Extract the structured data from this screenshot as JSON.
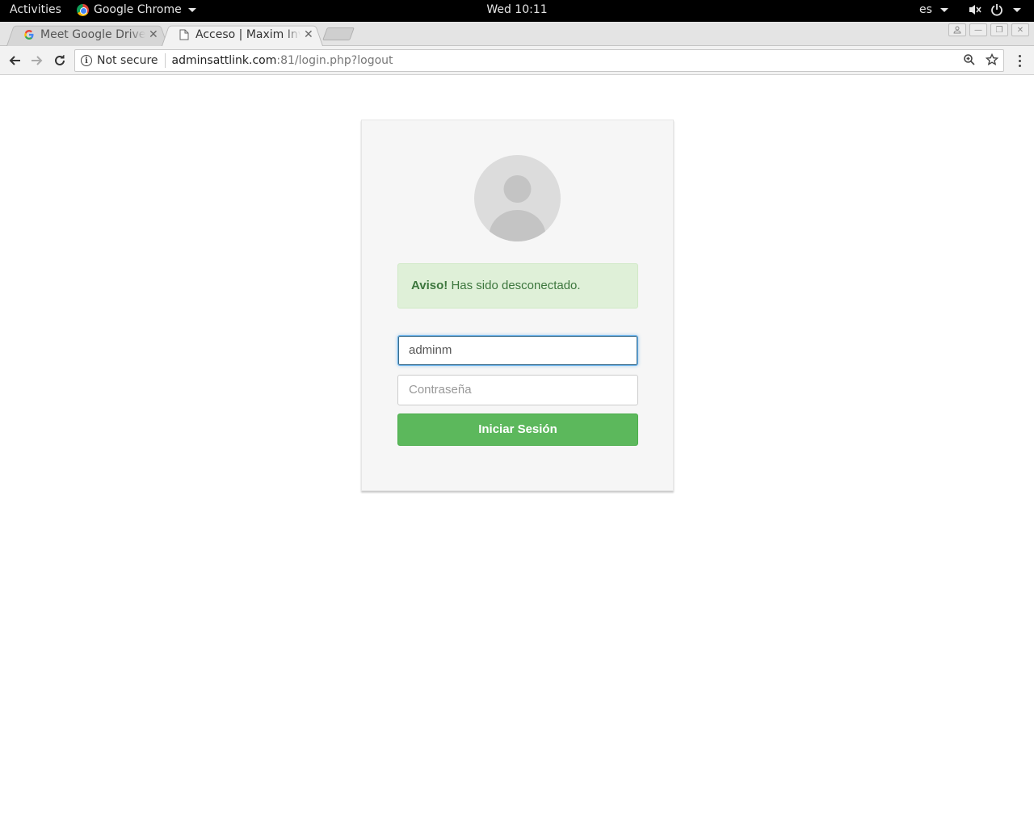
{
  "topbar": {
    "activities": "Activities",
    "app_name": "Google Chrome",
    "clock": "Wed 10:11",
    "lang": "es"
  },
  "tabs": [
    {
      "title": "Meet Google Drive",
      "icon": "google-icon",
      "active": false
    },
    {
      "title": "Acceso | Maxim Inventory",
      "icon": "page-icon",
      "active": true
    }
  ],
  "omnibox": {
    "security": "Not secure",
    "host": "adminsattlink.com",
    "rest": ":81/login.php?logout"
  },
  "login": {
    "alert_strong": "Aviso!",
    "alert_text": "Has sido desconectado.",
    "username_value": "adminm",
    "password_placeholder": "Contraseña",
    "submit_label": "Iniciar Sesión"
  },
  "colors": {
    "alert_bg": "#dff0d8",
    "alert_text": "#3c763d",
    "button_bg": "#5cb85c"
  }
}
